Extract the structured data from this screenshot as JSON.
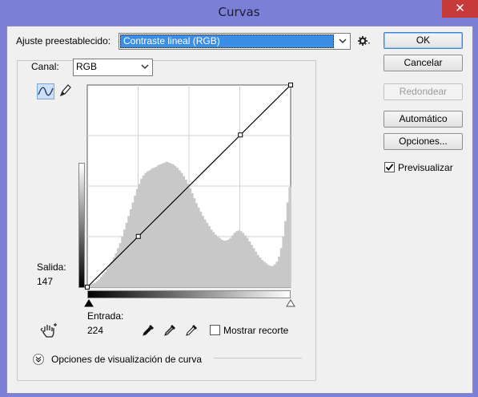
{
  "window": {
    "title": "Curvas",
    "close_glyph": "✕"
  },
  "preset": {
    "label": "Ajuste preestablecido:",
    "value": "Contraste lineal (RGB)"
  },
  "channel": {
    "label": "Canal:",
    "value": "RGB"
  },
  "buttons": {
    "ok": "OK",
    "cancel": "Cancelar",
    "round": "Redondear",
    "auto": "Automático",
    "options": "Opciones...",
    "preview": "Previsualizar",
    "preview_checked": true
  },
  "output": {
    "label": "Salida:",
    "value": "147"
  },
  "input": {
    "label": "Entrada:",
    "value": "224"
  },
  "show_clipping": {
    "label": "Mostrar recorte",
    "checked": false
  },
  "curve_display_options": {
    "label": "Opciones de visualización de curva"
  },
  "icons": {
    "curve_tool": "curve-icon",
    "pencil_tool": "pencil-icon",
    "hand_tool": "hand-icon",
    "settings": "gear-icon",
    "eyedropper_black": "eyedropper-icon",
    "eyedropper_gray": "eyedropper-icon",
    "eyedropper_white": "eyedropper-icon",
    "expand": "chevron-down-icon"
  },
  "colors": {
    "title_bar": "#7b7fd6",
    "selection": "#3a8ee6",
    "close_button": "#c73a3a",
    "histogram": "#c8c8c8"
  },
  "chart_data": {
    "type": "line",
    "x_range": [
      0,
      255
    ],
    "y_range": [
      0,
      255
    ],
    "grid": "4x4",
    "curve_points": [
      [
        0,
        0
      ],
      [
        64,
        64
      ],
      [
        192,
        192
      ],
      [
        255,
        255
      ]
    ],
    "histogram": [
      2,
      3,
      4,
      5,
      7,
      9,
      12,
      15,
      18,
      22,
      26,
      30,
      35,
      40,
      46,
      52,
      60,
      68,
      76,
      84,
      92,
      100,
      108,
      116,
      122,
      128,
      132,
      135,
      137,
      138,
      140,
      141,
      142,
      144,
      145,
      146,
      147,
      148,
      147,
      146,
      145,
      143,
      141,
      138,
      135,
      131,
      127,
      122,
      117,
      111,
      105,
      99,
      94,
      89,
      84,
      80,
      76,
      72,
      68,
      65,
      62,
      60,
      58,
      56,
      55,
      55,
      56,
      58,
      61,
      64,
      66,
      67,
      66,
      64,
      61,
      58,
      54,
      50,
      46,
      42,
      38,
      35,
      32,
      30,
      28,
      26,
      25,
      25,
      27,
      30,
      36,
      46,
      60,
      78,
      100,
      118
    ]
  }
}
